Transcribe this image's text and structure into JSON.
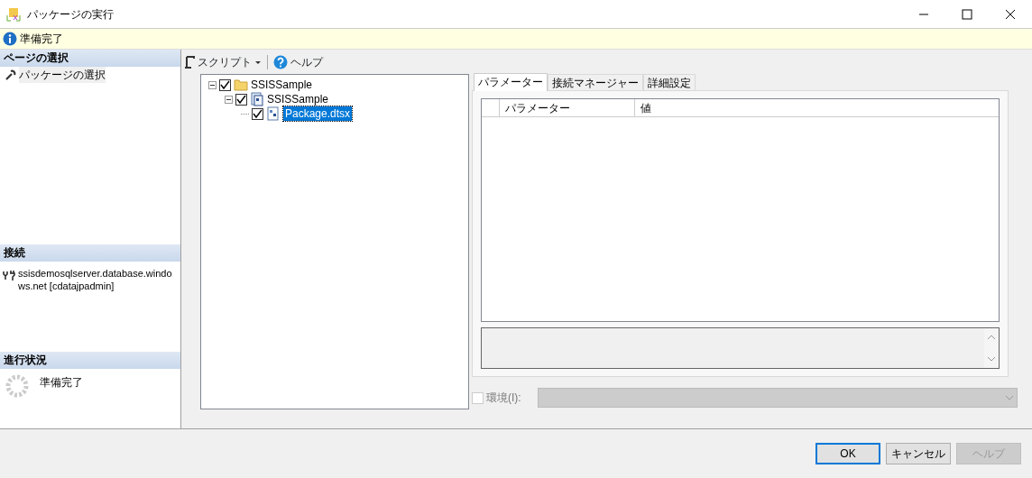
{
  "window": {
    "title": "パッケージの実行"
  },
  "info_bar": {
    "text": "準備完了"
  },
  "sidebar": {
    "page_section": {
      "title": "ページの選択",
      "items": [
        {
          "label": "パッケージの選択",
          "selected": true
        }
      ]
    },
    "connection_section": {
      "title": "接続",
      "text": "ssisdemosqlserver.database.windows.net [cdatajpadmin]"
    },
    "progress_section": {
      "title": "進行状況",
      "text": "準備完了"
    }
  },
  "toolbar": {
    "script": "スクリプト",
    "help": "ヘルプ"
  },
  "tree": [
    {
      "label": "SSISSample",
      "kind": "folder",
      "checked": true,
      "expanded": true,
      "selected": false,
      "children": [
        {
          "label": "SSISSample",
          "kind": "project",
          "checked": true,
          "expanded": true,
          "selected": false,
          "children": [
            {
              "label": "Package.dtsx",
              "kind": "package",
              "checked": true,
              "selected": true
            }
          ]
        }
      ]
    }
  ],
  "tabs": [
    {
      "label": "パラメーター",
      "selected": true
    },
    {
      "label": "接続マネージャー",
      "selected": false
    },
    {
      "label": "詳細設定",
      "selected": false
    }
  ],
  "grid": {
    "columns": [
      "パラメーター",
      "値"
    ]
  },
  "environment": {
    "label": "環境(I):",
    "checked": false,
    "disabled": true
  },
  "buttons": [
    {
      "label": "OK",
      "default": true,
      "disabled": false
    },
    {
      "label": "キャンセル",
      "default": false,
      "disabled": false
    },
    {
      "label": "ヘルプ",
      "default": false,
      "disabled": true
    }
  ]
}
